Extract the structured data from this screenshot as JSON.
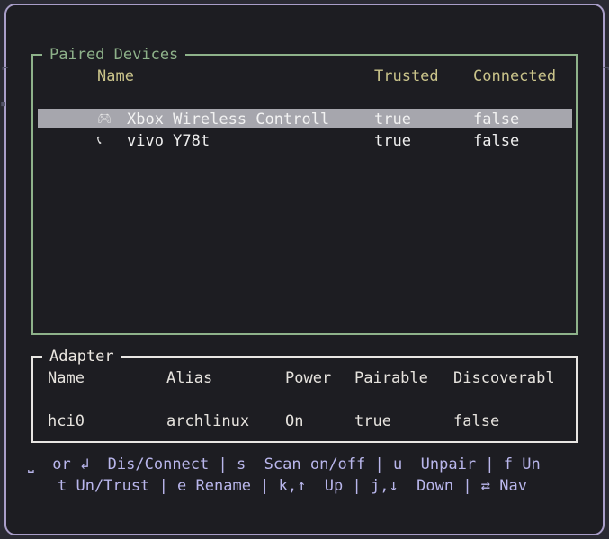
{
  "paired": {
    "title": "Paired Devices",
    "columns": {
      "name": "Name",
      "trusted": "Trusted",
      "connected": "Connected"
    },
    "rows": [
      {
        "icon": "gamepad-icon",
        "glyph": "🎮︎",
        "name": "Xbox Wireless Controll",
        "trusted": "true",
        "connected": "false",
        "selected": true
      },
      {
        "icon": "phone-icon",
        "glyph": "📞︎",
        "name": "vivo Y78t",
        "trusted": "true",
        "connected": "false",
        "selected": false
      }
    ]
  },
  "adapter": {
    "title": "Adapter",
    "columns": {
      "name": "Name",
      "alias": "Alias",
      "power": "Power",
      "pairable": "Pairable",
      "discoverable": "Discoverabl"
    },
    "values": {
      "name": "hci0",
      "alias": "archlinux",
      "power": "On",
      "pairable": "true",
      "discoverable": "false"
    }
  },
  "help": {
    "line1": "⎵  or ↲  Dis/Connect | s  Scan on/off | u  Unpair | f Un",
    "line2": "t Un/Trust | e Rename | k,↑  Up | j,↓  Down | ⇄ Nav"
  },
  "colors": {
    "window_border": "#a99ec9",
    "paired_border": "#8eb28a",
    "header_text": "#c9c38a",
    "selected_row": "#a6a6ad",
    "help_text": "#b9b6ec"
  }
}
